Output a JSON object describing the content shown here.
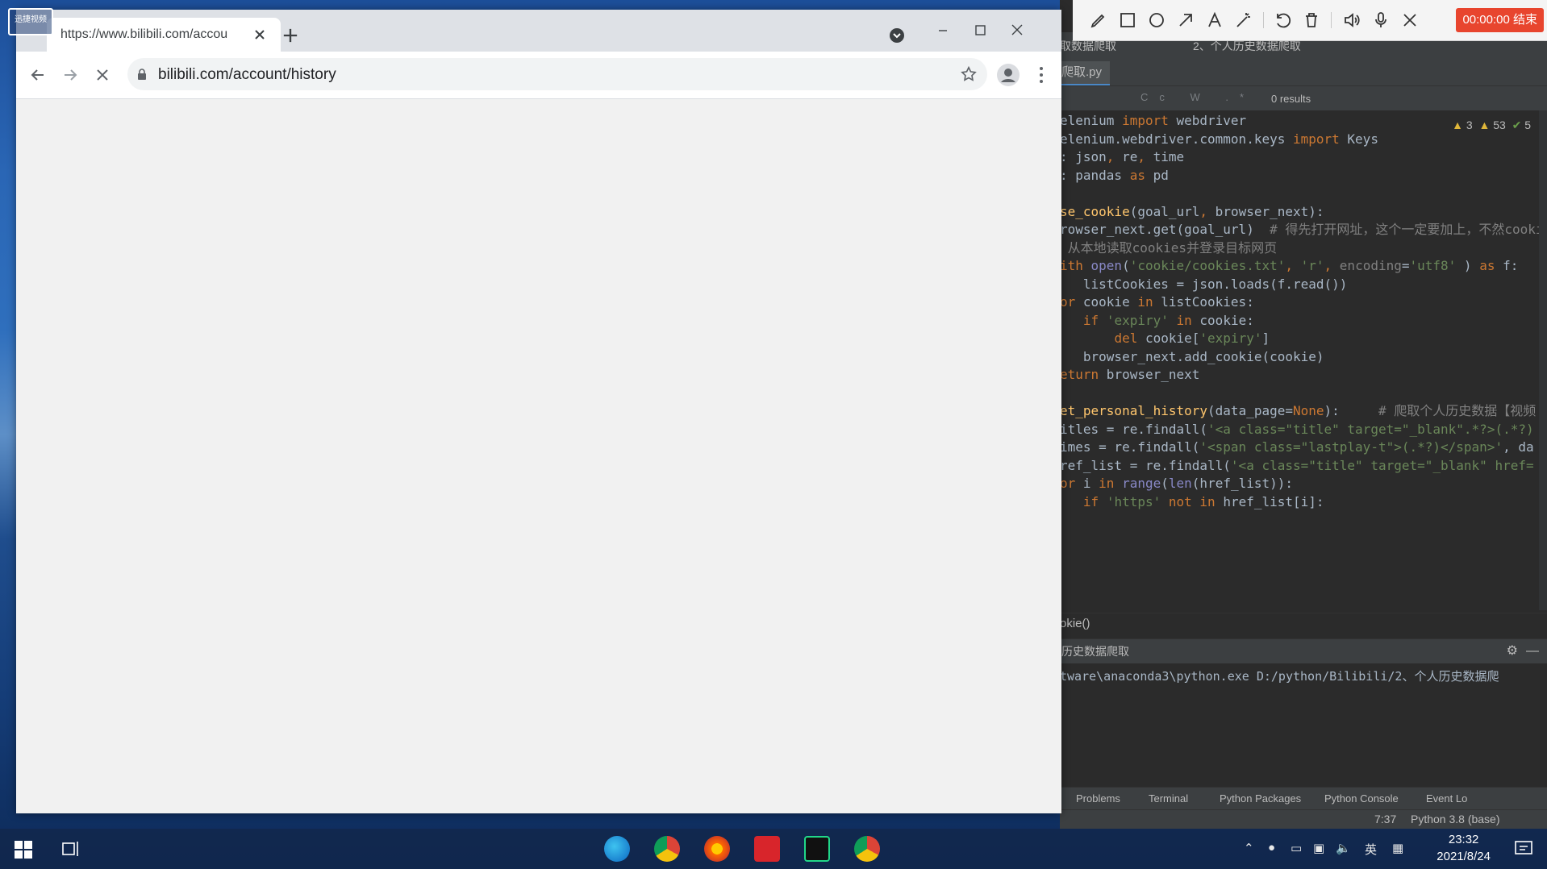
{
  "browser": {
    "tab_title": "https://www.bilibili.com/accou",
    "url": "bilibili.com/account/history"
  },
  "ide": {
    "breadcrumb": "取数据爬取",
    "branch": "2、个人历史数据爬取",
    "file_tab": "爬取.py",
    "find_results": "0 results",
    "inspections": {
      "warnings": "3",
      "weak_warnings": "53",
      "ok": "5"
    },
    "code_lines": [
      [
        [
          "",
          "elenium "
        ],
        [
          "kw",
          "import"
        ],
        [
          "",
          " webdriver"
        ]
      ],
      [
        [
          "",
          "elenium.webdriver.common.keys "
        ],
        [
          "kw",
          "import"
        ],
        [
          "",
          " Keys"
        ]
      ],
      [
        [
          "",
          ": json"
        ],
        [
          "kw",
          ","
        ],
        [
          "",
          " re"
        ],
        [
          "kw",
          ","
        ],
        [
          "",
          " time"
        ]
      ],
      [
        [
          "",
          ": pandas "
        ],
        [
          "kw",
          "as"
        ],
        [
          "",
          " pd"
        ]
      ],
      [],
      [
        [
          "fn",
          "se_cookie"
        ],
        [
          "",
          "(goal_url"
        ],
        [
          "kw",
          ","
        ],
        [
          "",
          " browser_next):"
        ]
      ],
      [
        [
          "",
          "rowser_next.get(goal_url)  "
        ],
        [
          "cm",
          "# 得先打开网址，这个一定要加上，不然cookie"
        ]
      ],
      [
        [
          "cm",
          " 从本地读取cookies并登录目标网页"
        ]
      ],
      [
        [
          "kw",
          "ith "
        ],
        [
          "bi",
          "open"
        ],
        [
          "",
          "("
        ],
        [
          "str",
          "'cookie/cookies.txt'"
        ],
        [
          "kw",
          ", "
        ],
        [
          "str",
          "'r'"
        ],
        [
          "kw",
          ", "
        ],
        [
          "cm",
          "encoding"
        ],
        [
          "",
          "="
        ],
        [
          "str",
          "'utf8'"
        ],
        [
          "",
          " ) "
        ],
        [
          "kw",
          "as"
        ],
        [
          "",
          " f:"
        ]
      ],
      [
        [
          "",
          "   listCookies = json.loads(f.read())"
        ]
      ],
      [
        [
          "kw",
          "or"
        ],
        [
          "",
          " cookie "
        ],
        [
          "kw",
          "in"
        ],
        [
          "",
          " listCookies:"
        ]
      ],
      [
        [
          "",
          "   "
        ],
        [
          "kw",
          "if "
        ],
        [
          "str",
          "'expiry'"
        ],
        [
          "kw",
          " in"
        ],
        [
          "",
          " cookie:"
        ]
      ],
      [
        [
          "",
          "       "
        ],
        [
          "kw",
          "del"
        ],
        [
          "",
          " cookie["
        ],
        [
          "str",
          "'expiry'"
        ],
        [
          "",
          "]"
        ]
      ],
      [
        [
          "",
          "   browser_next.add_cookie(cookie)"
        ]
      ],
      [
        [
          "kw",
          "eturn"
        ],
        [
          "",
          " browser_next"
        ]
      ],
      [],
      [
        [
          "fn",
          "et_personal_history"
        ],
        [
          "",
          "(data_page="
        ],
        [
          "kw",
          "None"
        ],
        [
          "",
          "):     "
        ],
        [
          "cm",
          "# 爬取个人历史数据【视频"
        ]
      ],
      [
        [
          "",
          "itles = re.findall("
        ],
        [
          "str",
          "'<a class=\"title\" target=\"_blank\".*?>(.*?)"
        ]
      ],
      [
        [
          "",
          "imes = re.findall("
        ],
        [
          "str",
          "'<span class=\"lastplay-t\">(.*?)</span>'"
        ],
        [
          "",
          ", da"
        ]
      ],
      [
        [
          "",
          "ref_list = re.findall("
        ],
        [
          "str",
          "'<a class=\"title\" target=\"_blank\" href="
        ]
      ],
      [
        [
          "kw",
          "or"
        ],
        [
          "",
          " i "
        ],
        [
          "kw",
          "in "
        ],
        [
          "bi",
          "range"
        ],
        [
          "",
          "("
        ],
        [
          "bi",
          "len"
        ],
        [
          "",
          "(href_list)):"
        ]
      ],
      [
        [
          "",
          "   "
        ],
        [
          "kw",
          "if "
        ],
        [
          "str",
          "'https'"
        ],
        [
          "kw",
          " not in"
        ],
        [
          "",
          " href_list[i]:"
        ]
      ]
    ],
    "code_crumb": "okie()",
    "run_tab": "历史数据爬取",
    "console_line": "tware\\anaconda3\\python.exe D:/python/Bilibili/2、个人历史数据爬",
    "bottom_tabs": [
      "Problems",
      "Terminal",
      "Python Packages",
      "Python Console",
      "Event Lo"
    ],
    "status_position": "7:37",
    "status_interpreter": "Python 3.8 (base)"
  },
  "recorder": {
    "timer": "00:00:00 结束"
  },
  "corner_logo": "迅捷视频",
  "taskbar": {
    "time": "23:32",
    "date": "2021/8/24",
    "ime": "英"
  },
  "colors": {
    "recorder_red": "#e8452e",
    "ide_bg": "#2b2b2b",
    "chrome_frame": "#dee1e6"
  }
}
